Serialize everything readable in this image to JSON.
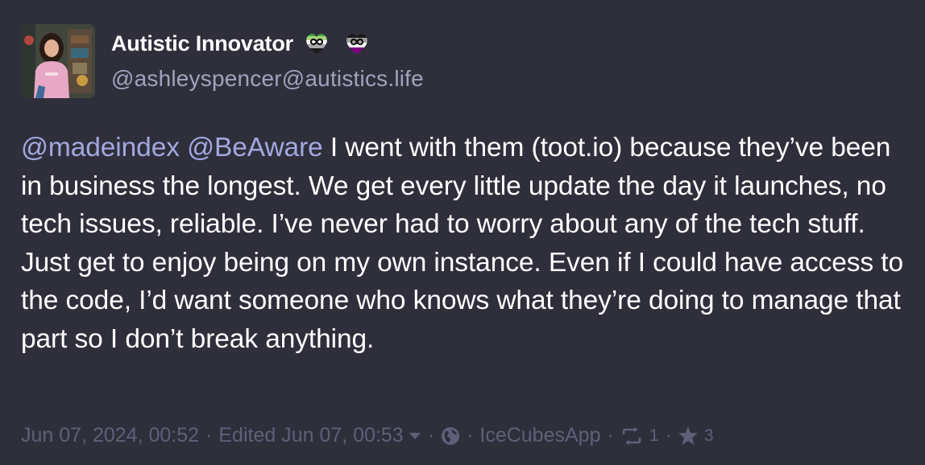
{
  "author": {
    "display_name": "Autistic Innovator",
    "handle": "@ashleyspencer@autistics.life",
    "name_emojis": [
      "aromantic-heart-infinity-emoji",
      "asexual-heart-infinity-emoji"
    ]
  },
  "post": {
    "mention_1": "@madeindex",
    "mention_2": "@BeAware",
    "text": " I went with them (toot.io) because they’ve been in business the longest. We get every little update the day it launches, no tech issues, reliable. I’ve never had to worry about any of the tech stuff. Just get to enjoy being on my own instance. Even if I could have access to the code, I’d want someone who knows what they’re doing to manage that part so I don’t break anything."
  },
  "meta": {
    "date": "Jun 07, 2024, 00:52",
    "edited": "Edited Jun 07, 00:53",
    "separator": "·",
    "visibility_icon": "globe-icon",
    "app": "IceCubesApp",
    "boost_count": "1",
    "favourite_count": "3"
  },
  "colors": {
    "background": "#2f2f3c",
    "text": "#ffffff",
    "handle": "#9ea4bd",
    "mention": "#a3a8df",
    "meta": "#5d6078"
  }
}
